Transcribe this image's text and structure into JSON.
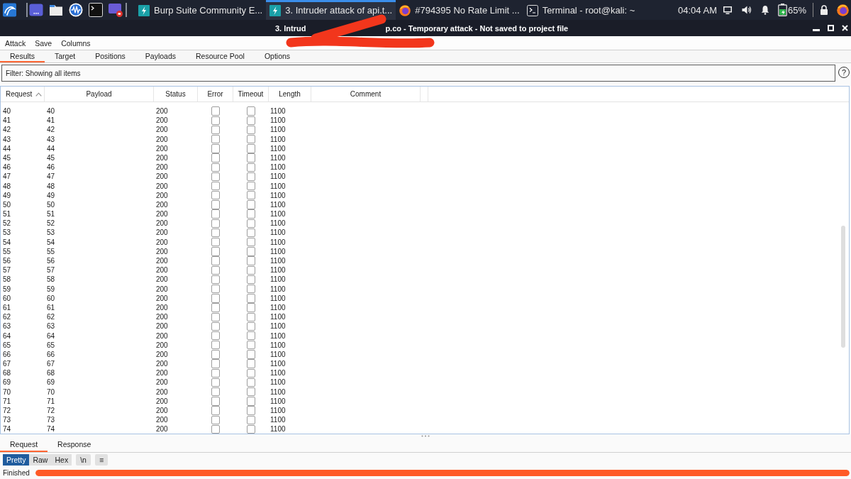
{
  "taskbar": {
    "tasks": [
      {
        "kind": "burp",
        "label": "Burp Suite Community E...",
        "selected": false
      },
      {
        "kind": "burp",
        "label": "3. Intruder attack of api.t...",
        "selected": true
      },
      {
        "kind": "browser",
        "label": "#794395 No Rate Limit ...",
        "selected": false
      },
      {
        "kind": "terminal",
        "label": "Terminal - root@kali: ~",
        "selected": false
      }
    ],
    "clock": "04:04 AM",
    "battery": "65%"
  },
  "window": {
    "title_start": "3. Intrud",
    "title_end": "p.co - Temporary attack - Not saved to project file"
  },
  "menu": [
    "Attack",
    "Save",
    "Columns"
  ],
  "tabs": [
    {
      "label": "Results",
      "selected": true
    },
    {
      "label": "Target",
      "selected": false
    },
    {
      "label": "Positions",
      "selected": false
    },
    {
      "label": "Payloads",
      "selected": false
    },
    {
      "label": "Resource Pool",
      "selected": false
    },
    {
      "label": "Options",
      "selected": false
    }
  ],
  "filter": {
    "label": "Filter: Showing all items",
    "help": "?"
  },
  "table": {
    "columns": [
      {
        "label": "Request",
        "sorted": true
      },
      {
        "label": "Payload",
        "sorted": false
      },
      {
        "label": "Status",
        "sorted": false
      },
      {
        "label": "Error",
        "sorted": false
      },
      {
        "label": "Timeout",
        "sorted": false
      },
      {
        "label": "Length",
        "sorted": false
      },
      {
        "label": "Comment",
        "sorted": false
      }
    ],
    "rows": [
      {
        "request": "40",
        "payload": "40",
        "status": "200",
        "error": false,
        "timeout": false,
        "length": "1100"
      },
      {
        "request": "41",
        "payload": "41",
        "status": "200",
        "error": false,
        "timeout": false,
        "length": "1100"
      },
      {
        "request": "42",
        "payload": "42",
        "status": "200",
        "error": false,
        "timeout": false,
        "length": "1100"
      },
      {
        "request": "43",
        "payload": "43",
        "status": "200",
        "error": false,
        "timeout": false,
        "length": "1100"
      },
      {
        "request": "44",
        "payload": "44",
        "status": "200",
        "error": false,
        "timeout": false,
        "length": "1100"
      },
      {
        "request": "45",
        "payload": "45",
        "status": "200",
        "error": false,
        "timeout": false,
        "length": "1100"
      },
      {
        "request": "46",
        "payload": "46",
        "status": "200",
        "error": false,
        "timeout": false,
        "length": "1100"
      },
      {
        "request": "47",
        "payload": "47",
        "status": "200",
        "error": false,
        "timeout": false,
        "length": "1100"
      },
      {
        "request": "48",
        "payload": "48",
        "status": "200",
        "error": false,
        "timeout": false,
        "length": "1100"
      },
      {
        "request": "49",
        "payload": "49",
        "status": "200",
        "error": false,
        "timeout": false,
        "length": "1100"
      },
      {
        "request": "50",
        "payload": "50",
        "status": "200",
        "error": false,
        "timeout": false,
        "length": "1100"
      },
      {
        "request": "51",
        "payload": "51",
        "status": "200",
        "error": false,
        "timeout": false,
        "length": "1100"
      },
      {
        "request": "52",
        "payload": "52",
        "status": "200",
        "error": false,
        "timeout": false,
        "length": "1100"
      },
      {
        "request": "53",
        "payload": "53",
        "status": "200",
        "error": false,
        "timeout": false,
        "length": "1100"
      },
      {
        "request": "54",
        "payload": "54",
        "status": "200",
        "error": false,
        "timeout": false,
        "length": "1100"
      },
      {
        "request": "55",
        "payload": "55",
        "status": "200",
        "error": false,
        "timeout": false,
        "length": "1100"
      },
      {
        "request": "56",
        "payload": "56",
        "status": "200",
        "error": false,
        "timeout": false,
        "length": "1100"
      },
      {
        "request": "57",
        "payload": "57",
        "status": "200",
        "error": false,
        "timeout": false,
        "length": "1100"
      },
      {
        "request": "58",
        "payload": "58",
        "status": "200",
        "error": false,
        "timeout": false,
        "length": "1100"
      },
      {
        "request": "59",
        "payload": "59",
        "status": "200",
        "error": false,
        "timeout": false,
        "length": "1100"
      },
      {
        "request": "60",
        "payload": "60",
        "status": "200",
        "error": false,
        "timeout": false,
        "length": "1100"
      },
      {
        "request": "61",
        "payload": "61",
        "status": "200",
        "error": false,
        "timeout": false,
        "length": "1100"
      },
      {
        "request": "62",
        "payload": "62",
        "status": "200",
        "error": false,
        "timeout": false,
        "length": "1100"
      },
      {
        "request": "63",
        "payload": "63",
        "status": "200",
        "error": false,
        "timeout": false,
        "length": "1100"
      },
      {
        "request": "64",
        "payload": "64",
        "status": "200",
        "error": false,
        "timeout": false,
        "length": "1100"
      },
      {
        "request": "65",
        "payload": "65",
        "status": "200",
        "error": false,
        "timeout": false,
        "length": "1100"
      },
      {
        "request": "66",
        "payload": "66",
        "status": "200",
        "error": false,
        "timeout": false,
        "length": "1100"
      },
      {
        "request": "67",
        "payload": "67",
        "status": "200",
        "error": false,
        "timeout": false,
        "length": "1100"
      },
      {
        "request": "68",
        "payload": "68",
        "status": "200",
        "error": false,
        "timeout": false,
        "length": "1100"
      },
      {
        "request": "69",
        "payload": "69",
        "status": "200",
        "error": false,
        "timeout": false,
        "length": "1100"
      },
      {
        "request": "70",
        "payload": "70",
        "status": "200",
        "error": false,
        "timeout": false,
        "length": "1100"
      },
      {
        "request": "71",
        "payload": "71",
        "status": "200",
        "error": false,
        "timeout": false,
        "length": "1100"
      },
      {
        "request": "72",
        "payload": "72",
        "status": "200",
        "error": false,
        "timeout": false,
        "length": "1100"
      },
      {
        "request": "73",
        "payload": "73",
        "status": "200",
        "error": false,
        "timeout": false,
        "length": "1100"
      },
      {
        "request": "74",
        "payload": "74",
        "status": "200",
        "error": false,
        "timeout": false,
        "length": "1100"
      }
    ]
  },
  "detail_tabs": [
    {
      "label": "Request",
      "selected": true
    },
    {
      "label": "Response",
      "selected": false
    }
  ],
  "view_modes": [
    {
      "label": "Pretty",
      "selected": true
    },
    {
      "label": "Raw",
      "selected": false
    },
    {
      "label": "Hex",
      "selected": false
    }
  ],
  "newline_toggle": {
    "label": "\\n",
    "on": false
  },
  "menu_button": "≡",
  "status": {
    "text": "Finished",
    "level": 1
  }
}
